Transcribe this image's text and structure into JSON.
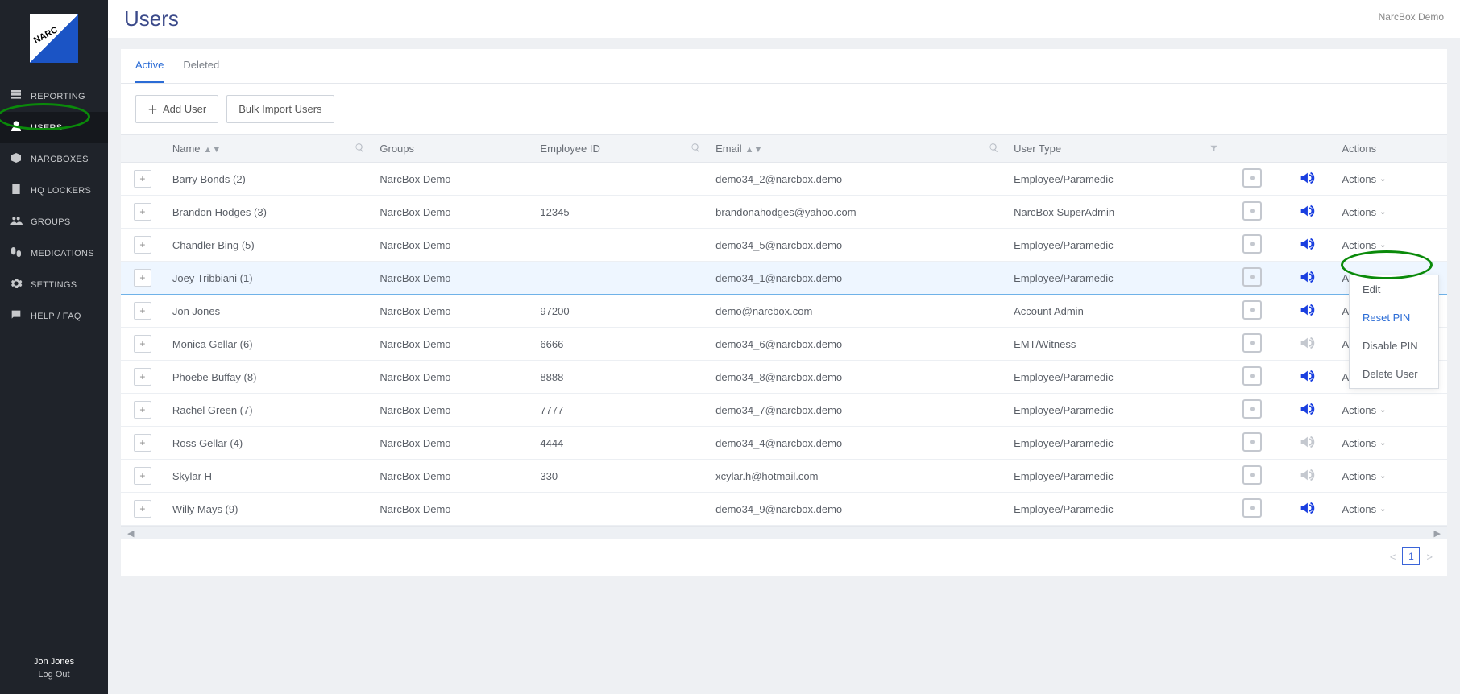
{
  "sidebar": {
    "items": [
      {
        "label": "REPORTING",
        "icon": "reporting-icon"
      },
      {
        "label": "USERS",
        "icon": "users-icon",
        "active": true
      },
      {
        "label": "NARCBOXES",
        "icon": "narcboxes-icon"
      },
      {
        "label": "HQ LOCKERS",
        "icon": "lockers-icon"
      },
      {
        "label": "GROUPS",
        "icon": "groups-icon"
      },
      {
        "label": "MEDICATIONS",
        "icon": "medications-icon"
      },
      {
        "label": "SETTINGS",
        "icon": "settings-icon"
      },
      {
        "label": "HELP / FAQ",
        "icon": "help-icon"
      }
    ],
    "footer": {
      "username": "Jon Jones",
      "logout_label": "Log Out"
    }
  },
  "header": {
    "title": "Users",
    "breadcrumb": "NarcBox Demo"
  },
  "tabs": [
    {
      "label": "Active",
      "active": true
    },
    {
      "label": "Deleted"
    }
  ],
  "toolbar": {
    "add_user": "Add User",
    "bulk_import": "Bulk Import Users"
  },
  "columns": {
    "name": "Name",
    "groups": "Groups",
    "employee_id": "Employee ID",
    "email": "Email",
    "user_type": "User Type",
    "actions": "Actions"
  },
  "rows": [
    {
      "name": "Barry Bonds (2)",
      "group": "NarcBox Demo",
      "emp": "",
      "email": "demo34_2@narcbox.demo",
      "type": "Employee/Paramedic",
      "sound": true
    },
    {
      "name": "Brandon Hodges (3)",
      "group": "NarcBox Demo",
      "emp": "12345",
      "email": "brandonahodges@yahoo.com",
      "type": "NarcBox SuperAdmin",
      "sound": true
    },
    {
      "name": "Chandler Bing (5)",
      "group": "NarcBox Demo",
      "emp": "",
      "email": "demo34_5@narcbox.demo",
      "type": "Employee/Paramedic",
      "sound": true
    },
    {
      "name": "Joey Tribbiani (1)",
      "group": "NarcBox Demo",
      "emp": "",
      "email": "demo34_1@narcbox.demo",
      "type": "Employee/Paramedic",
      "sound": true,
      "selected": true,
      "menu": true
    },
    {
      "name": "Jon Jones",
      "group": "NarcBox Demo",
      "emp": "97200",
      "email": "demo@narcbox.com",
      "type": "Account Admin",
      "sound": true
    },
    {
      "name": "Monica Gellar (6)",
      "group": "NarcBox Demo",
      "emp": "6666",
      "email": "demo34_6@narcbox.demo",
      "type": "EMT/Witness",
      "sound": false
    },
    {
      "name": "Phoebe Buffay (8)",
      "group": "NarcBox Demo",
      "emp": "8888",
      "email": "demo34_8@narcbox.demo",
      "type": "Employee/Paramedic",
      "sound": true
    },
    {
      "name": "Rachel Green (7)",
      "group": "NarcBox Demo",
      "emp": "7777",
      "email": "demo34_7@narcbox.demo",
      "type": "Employee/Paramedic",
      "sound": true
    },
    {
      "name": "Ross Gellar (4)",
      "group": "NarcBox Demo",
      "emp": "4444",
      "email": "demo34_4@narcbox.demo",
      "type": "Employee/Paramedic",
      "sound": false
    },
    {
      "name": "Skylar H",
      "group": "NarcBox Demo",
      "emp": "330",
      "email": "xcylar.h@hotmail.com",
      "type": "Employee/Paramedic",
      "sound": false
    },
    {
      "name": "Willy Mays (9)",
      "group": "NarcBox Demo",
      "emp": "",
      "email": "demo34_9@narcbox.demo",
      "type": "Employee/Paramedic",
      "sound": true
    }
  ],
  "actions_label": "Actions",
  "pager": {
    "page": "1"
  },
  "dropdown": {
    "edit": "Edit",
    "reset_pin": "Reset PIN",
    "disable_pin": "Disable PIN",
    "delete_user": "Delete User"
  }
}
